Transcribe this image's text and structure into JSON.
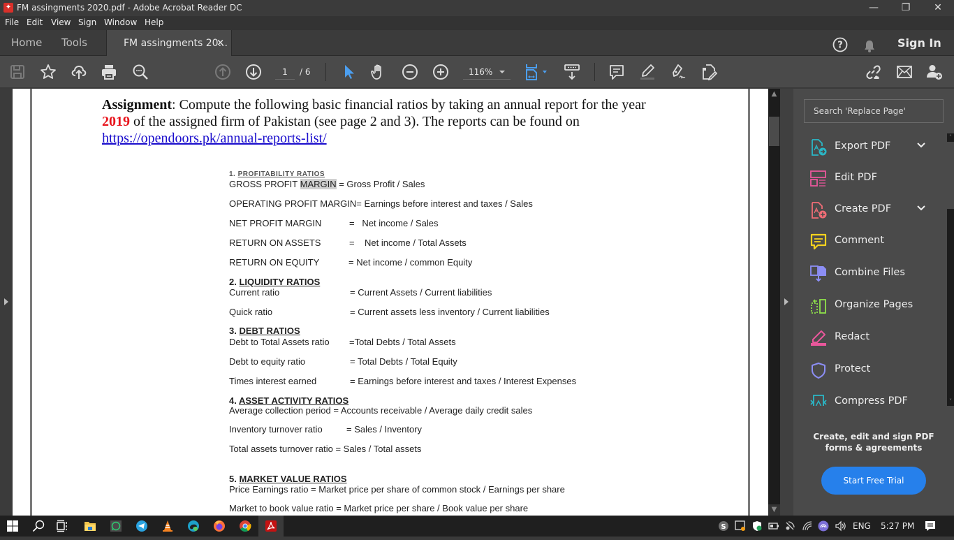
{
  "window": {
    "title": "FM assingments 2020.pdf - Adobe Acrobat Reader DC",
    "app_icon": "acrobat-icon",
    "controls": {
      "minimize": "—",
      "restore": "❐",
      "close": "✕"
    }
  },
  "menu": [
    "File",
    "Edit",
    "View",
    "Sign",
    "Window",
    "Help"
  ],
  "tabs": {
    "home": "Home",
    "tools": "Tools",
    "document": "FM assingments 20...",
    "close_glyph": "×"
  },
  "header_right": {
    "help_icon": "help-circle-icon",
    "notifications_icon": "bell-icon",
    "sign_in": "Sign In"
  },
  "toolbar": {
    "current_page": "1",
    "total_pages": "/ 6",
    "zoom_level": "116%",
    "accent_color": "#4c9ff0",
    "icons": [
      "save-icon",
      "bookmark-star-icon",
      "upload-cloud-icon",
      "print-icon",
      "search-zoom-icon",
      "page-up-icon",
      "page-down-icon",
      "select-cursor-icon",
      "hand-tool-icon",
      "zoom-out-icon",
      "zoom-in-icon",
      "fit-page-icon",
      "scroll-mode-icon",
      "comment-icon",
      "highlight-icon",
      "sign-icon",
      "fill-sign-icon",
      "share-link-icon",
      "email-icon",
      "add-user-icon"
    ]
  },
  "document": {
    "intro": {
      "label": "Assignment",
      "text_1": ": Compute the following basic financial ratios by taking an annual report for the year",
      "year": "2019",
      "text_2": " of the assigned firm of Pakistan (see page 2 and 3). The reports can be found on",
      "link": "https://opendoors.pk/annual-reports-list/"
    },
    "sections": [
      {
        "number": "1. ",
        "title": "PROFITABILITY RATIOS",
        "rows": [
          {
            "pre": "GROSS PROFIT ",
            "highlight": "MARGIN",
            "post": " = Gross Profit / Sales"
          },
          {
            "text": "OPERATING PROFIT MARGIN= Earnings before interest and taxes / Sales"
          },
          {
            "name": "NET PROFIT MARGIN",
            "formula": "=   Net income / Sales"
          },
          {
            "name": "RETURN ON ASSETS",
            "formula": "=    Net income / Total Assets"
          },
          {
            "name": "RETURN ON EQUITY",
            "formula": "= Net income / common Equity"
          }
        ]
      },
      {
        "number": "2. ",
        "title": "LIQUIDITY RATIOS",
        "rows": [
          {
            "name": "Current ratio",
            "formula": "= Current Assets / Current liabilities"
          },
          {
            "name": "Quick ratio",
            "formula": "= Current assets less inventory / Current liabilities"
          }
        ]
      },
      {
        "number": "3. ",
        "title": "DEBT RATIOS",
        "rows": [
          {
            "name": "Debt to Total Assets ratio",
            "formula": "=Total Debts / Total Assets"
          },
          {
            "name": "Debt to equity ratio",
            "formula": "= Total Debts / Total Equity"
          },
          {
            "name": "Times interest earned",
            "formula": "= Earnings before interest and taxes / Interest Expenses"
          }
        ]
      },
      {
        "number": "4. ",
        "title": "ASSET ACTIVITY RATIOS",
        "rows": [
          {
            "text": "Average collection period = Accounts receivable / Average daily credit sales"
          },
          {
            "name": "Inventory turnover ratio",
            "formula": "= Sales / Inventory"
          },
          {
            "text": "Total assets turnover ratio = Sales / Total assets"
          }
        ]
      },
      {
        "number": "5. ",
        "title": "MARKET VALUE RATIOS",
        "rows": [
          {
            "text": "Price Earnings ratio = Market price per share of common stock / Earnings per share"
          },
          {
            "text": "Market to book value ratio = Market price per share / Book value per share"
          }
        ]
      }
    ]
  },
  "right_panel": {
    "search_placeholder": "Search 'Replace Page'",
    "tools": [
      {
        "label": "Export PDF",
        "icon": "export-pdf-icon",
        "color": "#2ab7c6",
        "expandable": true
      },
      {
        "label": "Edit PDF",
        "icon": "edit-pdf-icon",
        "color": "#e8579b",
        "expandable": false
      },
      {
        "label": "Create PDF",
        "icon": "create-pdf-icon",
        "color": "#f06d76",
        "expandable": true
      },
      {
        "label": "Comment",
        "icon": "comment-icon",
        "color": "#f5d21e",
        "expandable": false
      },
      {
        "label": "Combine Files",
        "icon": "combine-files-icon",
        "color": "#8c8ef5",
        "expandable": false
      },
      {
        "label": "Organize Pages",
        "icon": "organize-pages-icon",
        "color": "#8ee04a",
        "expandable": false
      },
      {
        "label": "Redact",
        "icon": "redact-icon",
        "color": "#e8579b",
        "expandable": false
      },
      {
        "label": "Protect",
        "icon": "protect-shield-icon",
        "color": "#8c8ef5",
        "expandable": false
      },
      {
        "label": "Compress PDF",
        "icon": "compress-pdf-icon",
        "color": "#2ab7c6",
        "expandable": false
      }
    ],
    "promo_line1": "Create, edit and sign PDF",
    "promo_line2": "forms & agreements",
    "cta": "Start Free Trial",
    "cta_color": "#2680eb"
  },
  "taskbar": {
    "apps": [
      "windows-start-icon",
      "search-icon",
      "task-view-icon",
      "file-explorer-icon",
      "whatsapp-icon",
      "telegram-icon",
      "vlc-icon",
      "edge-icon",
      "firefox-icon",
      "chrome-icon",
      "acrobat-icon"
    ],
    "tray_icons": [
      "skype-icon",
      "screen-share-icon",
      "security-shield-icon",
      "battery-icon",
      "network-icon",
      "wifi-icon",
      "bittorrent-icon",
      "volume-icon"
    ],
    "language": "ENG",
    "time": "5:27 PM",
    "notifications_icon": "action-center-icon"
  }
}
